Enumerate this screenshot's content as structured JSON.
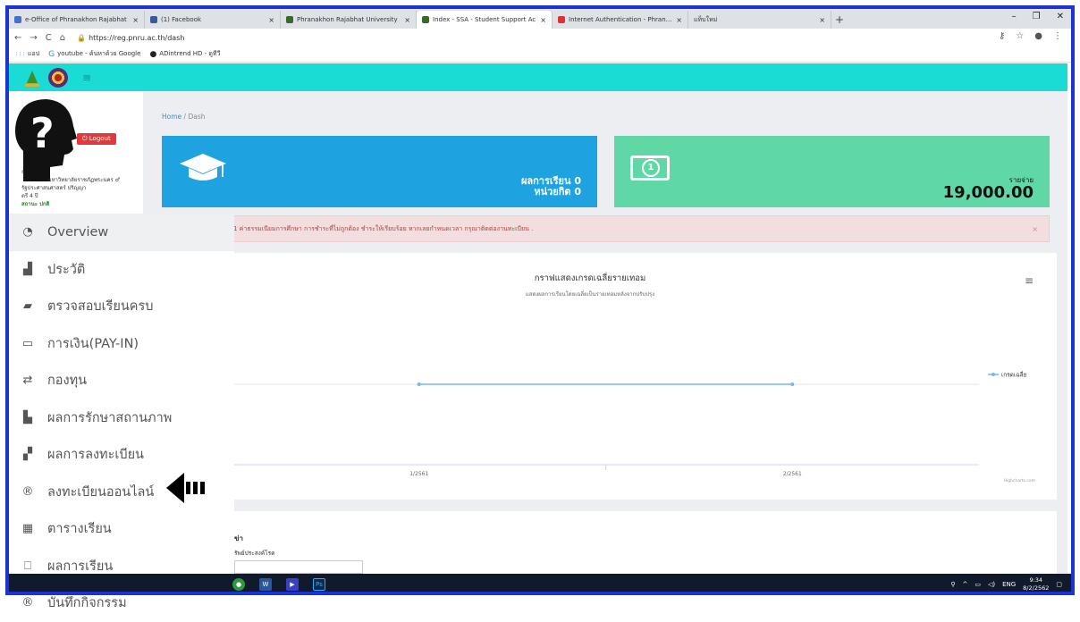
{
  "browser": {
    "tabs": [
      {
        "label": "e-Office of Phranakhon Rajabhat",
        "icon": "document-icon",
        "color": "#4a6ed0",
        "active": false
      },
      {
        "label": "(1) Facebook",
        "icon": "facebook-icon",
        "color": "#3b5998",
        "active": false
      },
      {
        "label": "Phranakhon Rajabhat University",
        "icon": "university-icon",
        "color": "#3a6a2a",
        "active": false
      },
      {
        "label": "Index - SSA - Student Support Ac",
        "icon": "university-icon",
        "color": "#3a6a2a",
        "active": true
      },
      {
        "label": "Internet Authentication - Phranak",
        "icon": "opera-icon",
        "color": "#e03030",
        "active": false
      },
      {
        "label": "แท็บใหม่",
        "icon": "",
        "color": "",
        "active": false
      }
    ],
    "url": "https://reg.pnru.ac.th/dash",
    "bookmarks": [
      {
        "label": "แอป",
        "icon": "apps-icon"
      },
      {
        "label": "youtube - ค้นหาด้วย Google",
        "icon": "google-icon"
      },
      {
        "label": "ADintrend HD - ดูทีวี",
        "icon": "circle-icon"
      }
    ]
  },
  "sidebar": {
    "logout_label": "Logout",
    "user_lines": [
      "ธ",
      "มหาวิทยาลัยราชภัฏพระนคร ♂",
      "รัฐประศาสนศาสตร์ ปริญญา",
      "ตรี 4 ปี",
      "สถานะ ปกติ"
    ],
    "menu": [
      {
        "label": "Overview",
        "icon": "dashboard-icon"
      },
      {
        "label": "ประวัติ",
        "icon": "user-icon"
      },
      {
        "label": "ตรวจสอบเรียนครบ",
        "icon": "book-icon"
      },
      {
        "label": "การเงิน(PAY-IN)",
        "icon": "money-icon"
      },
      {
        "label": "กองทุน",
        "icon": "exchange-icon"
      },
      {
        "label": "ผลการรักษาสถานภาพ",
        "icon": "file-icon"
      },
      {
        "label": "ผลการลงทะเบียน",
        "icon": "note-icon"
      },
      {
        "label": "ลงทะเบียนออนไลน์",
        "icon": "registered-icon"
      },
      {
        "label": "ตารางเรียน",
        "icon": "calendar-icon"
      },
      {
        "label": "ผลการเรียน",
        "icon": "bookmark-icon"
      },
      {
        "label": "บันทึกกิจกรรม",
        "icon": "registered-icon"
      }
    ]
  },
  "breadcrumb": {
    "home": "Home",
    "current": "Dash"
  },
  "stats_blue": {
    "line1": "ผลการเรียน 0",
    "line2": "หน่วยกิต 0"
  },
  "stats_green": {
    "label": "รายจ่าย",
    "value": "19,000.00"
  },
  "alert": {
    "text": "1 ค่าธรรมเนียมการศึกษา การชำระที่ไม่ถูกต้อง ชำระให้เรียบร้อย หากเลยกำหนดเวลา กรุณาติดต่องานทะเบียน ."
  },
  "chart_data": {
    "type": "line",
    "title": "กราฟแสดงเกรดเฉลี่ยรายเทอม",
    "subtitle": "แสดงผลการเรียนโดยเฉลี่ยเป็นรายเทอมหลังจากปรับปรุง",
    "categories": [
      "1/2561",
      "2/2561"
    ],
    "series": [
      {
        "name": "เกรดเฉลี่ย",
        "values": [
          0,
          0
        ]
      }
    ],
    "ylim": [
      0,
      1
    ],
    "xlabel": "",
    "ylabel": "",
    "legend": "right",
    "credits": "Highcharts.com",
    "color": "#7cb5ec"
  },
  "panel2": {
    "title": "ข่า",
    "subtitle": "รัพย์ประสงค์โรค"
  },
  "taskbar": {
    "time": "9:34",
    "date": "8/2/2562",
    "lang": "ENG"
  }
}
